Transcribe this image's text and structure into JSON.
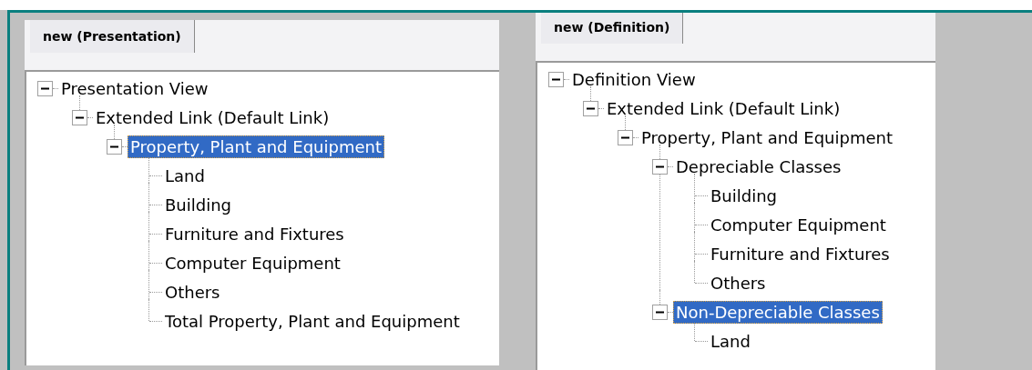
{
  "panels": [
    {
      "tab": {
        "label": "new (Presentation)"
      },
      "tree": [
        {
          "label": "Presentation View",
          "expanded": true,
          "selected": false,
          "children": [
            {
              "label": "Extended Link (Default Link)",
              "expanded": true,
              "selected": false,
              "children": [
                {
                  "label": "Property, Plant and Equipment",
                  "expanded": true,
                  "selected": true,
                  "children": [
                    {
                      "label": "Land",
                      "selected": false
                    },
                    {
                      "label": "Building",
                      "selected": false
                    },
                    {
                      "label": "Furniture and Fixtures",
                      "selected": false
                    },
                    {
                      "label": "Computer Equipment",
                      "selected": false
                    },
                    {
                      "label": "Others",
                      "selected": false
                    },
                    {
                      "label": "Total Property, Plant and Equipment",
                      "selected": false
                    }
                  ]
                }
              ]
            }
          ]
        }
      ]
    },
    {
      "tab": {
        "label": "new (Definition)"
      },
      "tree": [
        {
          "label": "Definition View",
          "expanded": true,
          "selected": false,
          "children": [
            {
              "label": "Extended Link (Default Link)",
              "expanded": true,
              "selected": false,
              "children": [
                {
                  "label": "Property, Plant and Equipment",
                  "expanded": true,
                  "selected": false,
                  "children": [
                    {
                      "label": "Depreciable Classes",
                      "expanded": true,
                      "selected": false,
                      "children": [
                        {
                          "label": "Building",
                          "selected": false
                        },
                        {
                          "label": "Computer Equipment",
                          "selected": false
                        },
                        {
                          "label": "Furniture and Fixtures",
                          "selected": false
                        },
                        {
                          "label": "Others",
                          "selected": false
                        }
                      ]
                    },
                    {
                      "label": "Non-Depreciable Classes",
                      "expanded": true,
                      "selected": true,
                      "children": [
                        {
                          "label": "Land",
                          "selected": false
                        }
                      ]
                    }
                  ]
                }
              ]
            }
          ]
        }
      ]
    }
  ]
}
